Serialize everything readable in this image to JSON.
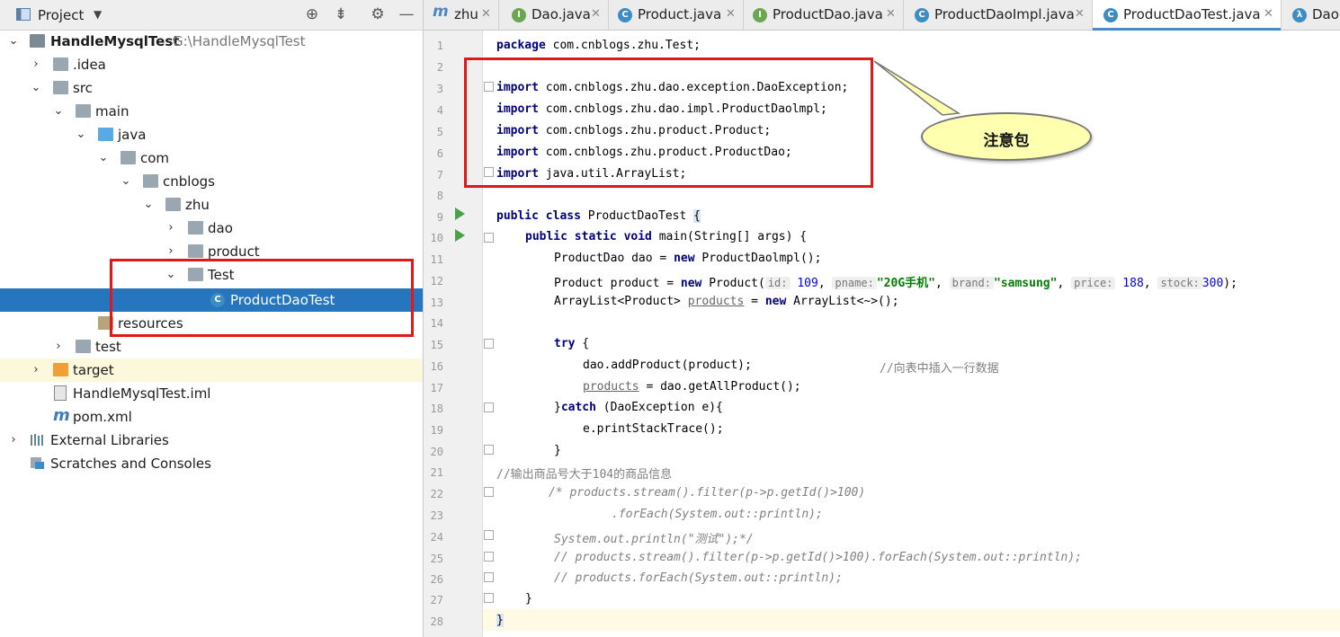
{
  "project_panel": {
    "title": "Project",
    "tools": [
      "target-icon",
      "collapse-icon",
      "gear-icon",
      "minimize-icon"
    ]
  },
  "tree": [
    {
      "label": "HandleMysqlTest",
      "sub": "G:\\HandleMysqlTest",
      "icon": "module-folder-icon",
      "expanded": true
    },
    {
      "label": ".idea",
      "icon": "folder-icon",
      "expanded": false
    },
    {
      "label": "src",
      "icon": "folder-icon",
      "expanded": true
    },
    {
      "label": "main",
      "icon": "folder-icon",
      "expanded": true
    },
    {
      "label": "java",
      "icon": "source-folder-icon",
      "expanded": true
    },
    {
      "label": "com",
      "icon": "package-icon",
      "expanded": true
    },
    {
      "label": "cnblogs",
      "icon": "package-icon",
      "expanded": true
    },
    {
      "label": "zhu",
      "icon": "package-icon",
      "expanded": true
    },
    {
      "label": "dao",
      "icon": "package-icon",
      "expanded": false
    },
    {
      "label": "product",
      "icon": "package-icon",
      "expanded": false
    },
    {
      "label": "Test",
      "icon": "package-icon",
      "expanded": true
    },
    {
      "label": "ProductDaoTest",
      "icon": "java-class-icon",
      "selected": true
    },
    {
      "label": "resources",
      "icon": "resources-folder-icon"
    },
    {
      "label": "test",
      "icon": "folder-icon",
      "expanded": false
    },
    {
      "label": "target",
      "icon": "excluded-folder-icon",
      "expanded": false
    },
    {
      "label": "HandleMysqlTest.iml",
      "icon": "iml-file-icon"
    },
    {
      "label": "pom.xml",
      "icon": "maven-icon"
    },
    {
      "label": "External Libraries",
      "icon": "libraries-icon",
      "expanded": false
    },
    {
      "label": "Scratches and Consoles",
      "icon": "scratches-icon"
    }
  ],
  "tabs": [
    {
      "label": "zhu",
      "icon": "maven-icon",
      "color": "#4a88c7"
    },
    {
      "label": "Dao.java",
      "icon": "interface-icon",
      "color": "#6aa84f"
    },
    {
      "label": "Product.java",
      "icon": "class-icon",
      "color": "#3d8cc4"
    },
    {
      "label": "ProductDao.java",
      "icon": "interface-icon",
      "color": "#6aa84f"
    },
    {
      "label": "ProductDaoImpl.java",
      "icon": "class-icon",
      "color": "#3d8cc4"
    },
    {
      "label": "ProductDaoTest.java",
      "icon": "class-icon",
      "color": "#3d8cc4",
      "active": true
    },
    {
      "label": "DaoI",
      "icon": "lambda-icon",
      "color": "#3d8cc4"
    }
  ],
  "line_numbers": [
    "1",
    "2",
    "3",
    "4",
    "5",
    "6",
    "7",
    "8",
    "9",
    "10",
    "11",
    "12",
    "13",
    "14",
    "15",
    "16",
    "17",
    "18",
    "19",
    "20",
    "21",
    "22",
    "23",
    "24",
    "25",
    "26",
    "27",
    "28"
  ],
  "code": {
    "l1_kw": "package",
    "l1_rest": " com.cnblogs.zhu.Test;",
    "import_kw": "import",
    "l3": " com.cnblogs.zhu.dao.exception.DaoException;",
    "l4": " com.cnblogs.zhu.dao.impl.ProductDaolmpl;",
    "l5": " com.cnblogs.zhu.product.Product;",
    "l6": " com.cnblogs.zhu.product.ProductDao;",
    "l7": " java.util.ArrayList;",
    "l9_kw": "public class",
    "l9_name": " ProductDaoTest ",
    "l9_brace": "{",
    "l10_kw": "public static void",
    "l10_rest": " main(String[] args) {",
    "l11_a": "ProductDao dao = ",
    "l11_kw": "new",
    "l11_b": " ProductDaolmpl();",
    "l12_a": "Product product = ",
    "l12_kw": "new",
    "l12_b": " Product(",
    "hint_id": "id:",
    "val_id": "109",
    "hint_pname": "pname:",
    "val_pname": "\"20G手机\"",
    "hint_brand": "brand:",
    "val_brand": "\"samsung\"",
    "hint_price": "price:",
    "val_price": "188",
    "hint_stock": "stock:",
    "val_stock": "300",
    "l12_end": ");",
    "comma": ", ",
    "l13_a": "ArrayList<Product> ",
    "l13_var": "products",
    "l13_b": " = ",
    "l13_kw": "new",
    "l13_c": " ArrayList<~>();",
    "l15_kw": "try",
    "l15_rest": " {",
    "l16_code": "dao.addProduct(product);",
    "l16_cmt": "//向表中插入一行数据",
    "l17_var": "products",
    "l17_rest": " = dao.getAllProduct();",
    "l18_a": "}",
    "l18_kw": "catch",
    "l18_b": " (DaoException e){",
    "l19": "e.printStackTrace();",
    "l20": "}",
    "l21": "//输出商品号大于104的商品信息",
    "l22": "/* products.stream().filter(p->p.getId()>100)",
    "l23": ".forEach(System.out::println);",
    "l24": "System.out.println(\"测试\");*/",
    "l25": "// products.stream().filter(p->p.getId()>100).forEach(System.out::println);",
    "l26": "// products.forEach(System.out::println);",
    "l27": "}",
    "l28": "}"
  },
  "callout": {
    "text": "注意包"
  }
}
